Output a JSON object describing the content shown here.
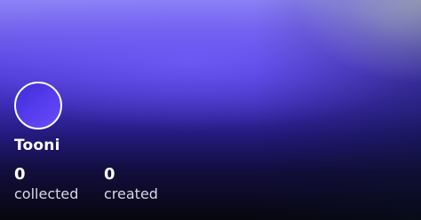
{
  "profile": {
    "name": "Tooni",
    "avatar_color": "#4a35e6"
  },
  "stats": [
    {
      "value": "0",
      "label": "collected"
    },
    {
      "value": "0",
      "label": "created"
    }
  ],
  "colors": {
    "banner_top": "#8b83f6",
    "banner_mid": "#5540df",
    "banner_bottom": "#07070f",
    "text": "#ffffff"
  }
}
